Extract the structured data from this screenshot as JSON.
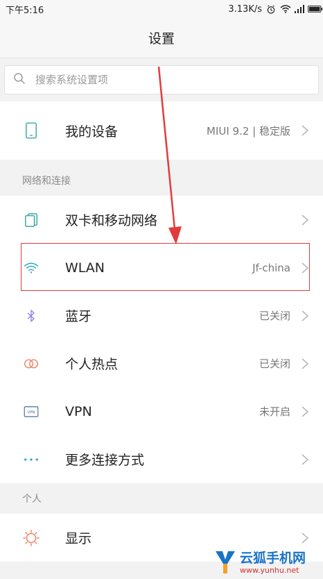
{
  "status_bar": {
    "time": "下午5:16",
    "speed": "3.13K/s"
  },
  "header": {
    "title": "设置"
  },
  "search": {
    "placeholder": "搜索系统设置项"
  },
  "my_device": {
    "label": "我的设备",
    "value": "MIUI 9.2 | 稳定版",
    "icon": "phone-icon"
  },
  "network_section": {
    "header": "网络和连接",
    "items": [
      {
        "label": "双卡和移动网络",
        "value": "",
        "icon": "sim-card-icon",
        "color": "#3aa7a0"
      },
      {
        "label": "WLAN",
        "value": "Jf-china",
        "icon": "wifi-icon",
        "color": "#2aa7c4"
      },
      {
        "label": "蓝牙",
        "value": "已关闭",
        "icon": "bluetooth-icon",
        "color": "#8f7ce6"
      },
      {
        "label": "个人热点",
        "value": "已关闭",
        "icon": "hotspot-icon",
        "color": "#f0846a"
      },
      {
        "label": "VPN",
        "value": "未开启",
        "icon": "vpn-icon",
        "color": "#4f6b8f"
      },
      {
        "label": "更多连接方式",
        "value": "",
        "icon": "more-dots-icon",
        "color": "#2aa7c4"
      }
    ]
  },
  "personal_section": {
    "header": "个人",
    "items": [
      {
        "label": "显示",
        "value": "",
        "icon": "brightness-icon",
        "color": "#f0846a"
      }
    ]
  },
  "watermark": {
    "title": "云狐手机网",
    "url": "www.yunhu.net"
  },
  "colors": {
    "annotation_red": "#e23b3b",
    "accent_teal": "#3aa7a0"
  }
}
